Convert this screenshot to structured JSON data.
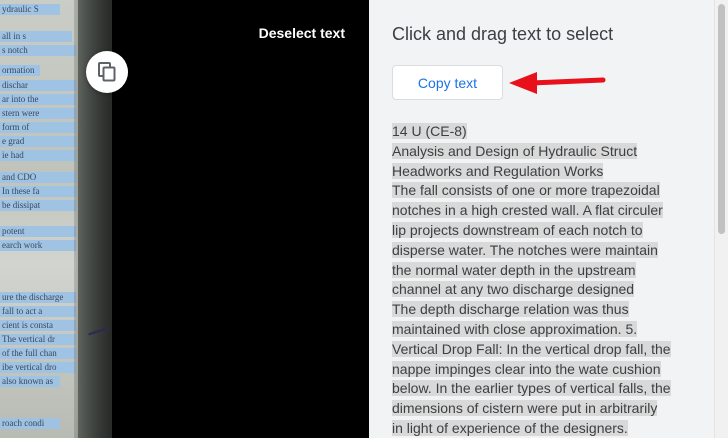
{
  "toolbar": {
    "deselect_label": "Deselect text",
    "copy_icon": "copy-icon"
  },
  "panel": {
    "heading": "Click and drag text to select",
    "copy_button_label": "Copy text",
    "annotation_arrow_color": "#e8101a",
    "lines": [
      "14 U (CE-8)",
      "Analysis and Design of Hydraulic Struct",
      "Headworks and Regulation Works",
      "The fall consists of one or more trapezoidal",
      "notches in a high crested wall. A flat circuler",
      "lip projects downstream of each notch to",
      "disperse water. The notches were maintain",
      "the normal water depth in the upstream",
      "channel at any two discharge designed",
      "The depth discharge relation was thus",
      "maintained with close approximation. 5.",
      "Vertical Drop Fall: In the vertical drop fall, the",
      "nappe impinges clear into the wate cushion",
      "below. In the earlier types of vertical falls, the",
      "dimensions of cistern were put in arbitrarily",
      "in light of experience of the designers."
    ]
  },
  "photo_text": [
    "ydraulic S",
    "all in s",
    "s notch",
    "ormation",
    "dischar",
    "ar into the",
    "stern were",
    "form of",
    "e grad",
    "ie had",
    "and CDO",
    "In these fa",
    "be dissipat",
    "potent",
    "earch work",
    "ure the discharge",
    "fall to act a",
    "cient is consta",
    "The vertical dr",
    "of the full chan",
    "ibe vertical dro",
    "also known as",
    "roach condi"
  ],
  "colors": {
    "black_panel": "#000000",
    "text_panel_bg": "#f1f3f4",
    "selection_highlight": "#d9d9d9",
    "photo_highlight": "#9ec3e6",
    "accent_blue": "#1a73e8"
  }
}
